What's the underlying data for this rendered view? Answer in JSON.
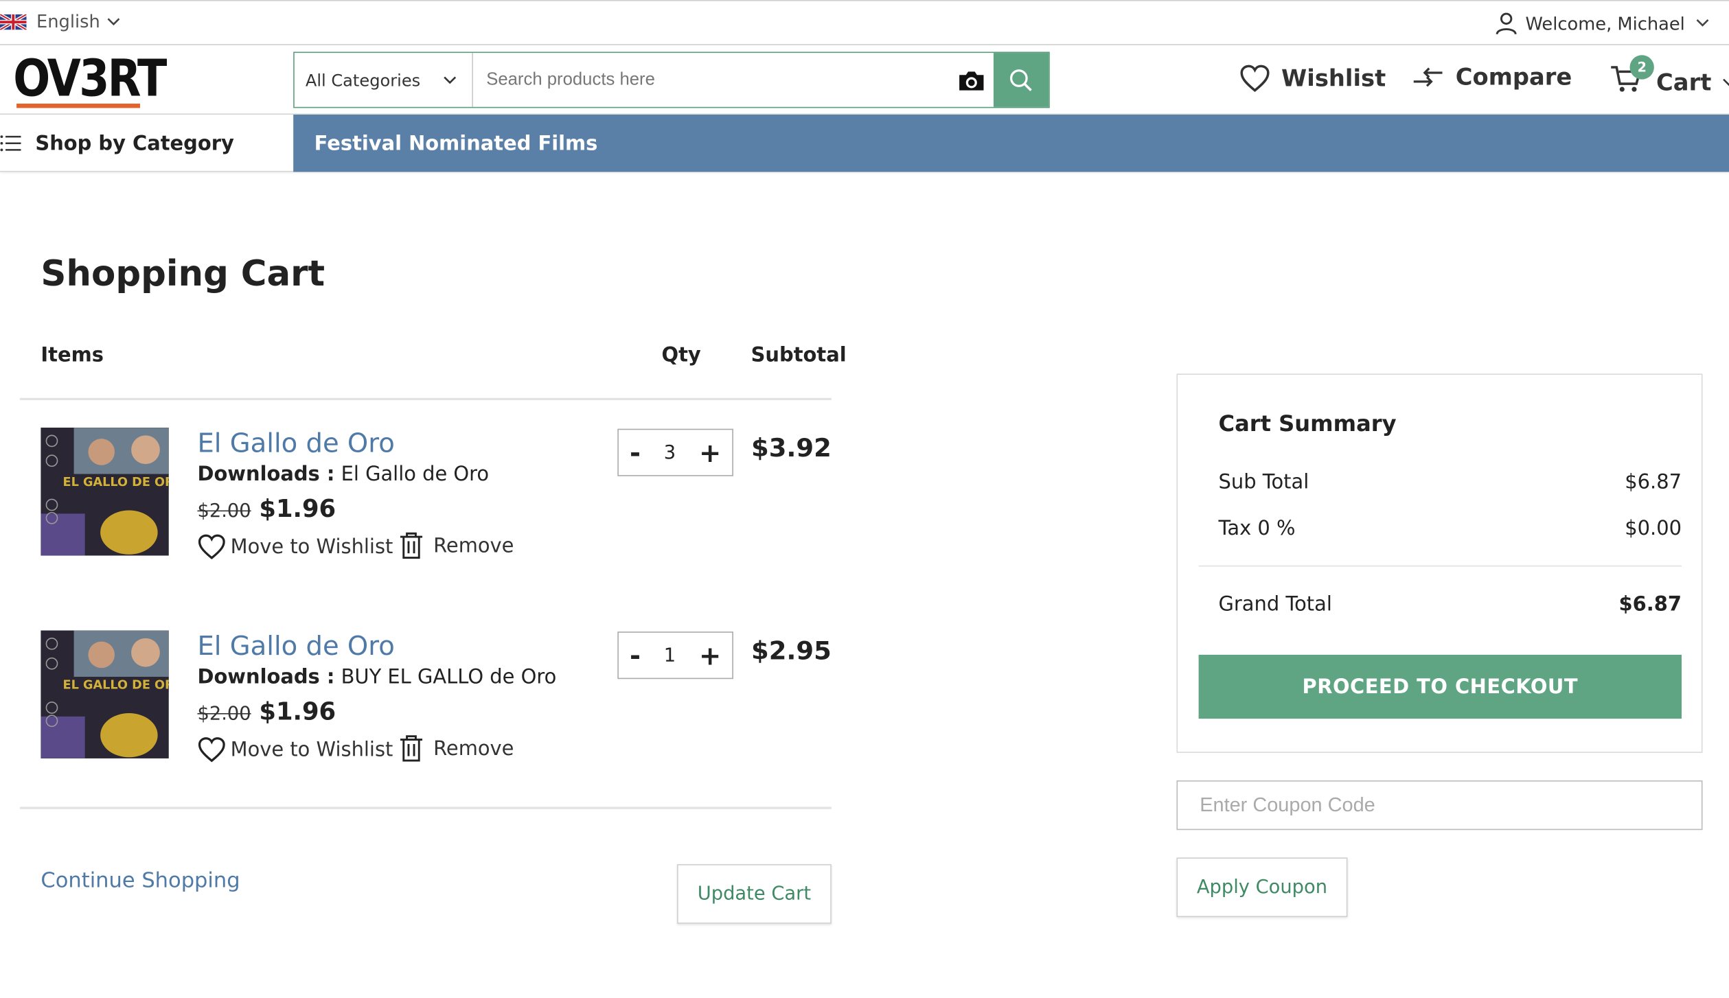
{
  "topbar": {
    "language": "English",
    "welcome": "Welcome, Michael"
  },
  "header": {
    "logo": "OV3RT",
    "category_select": "All Categories",
    "search_placeholder": "Search products here",
    "wishlist": "Wishlist",
    "compare": "Compare",
    "cart": "Cart",
    "cart_count": "2"
  },
  "nav": {
    "shop_by_category": "Shop by Category",
    "featured": "Festival Nominated Films"
  },
  "cart_page": {
    "title": "Shopping Cart",
    "columns": {
      "items": "Items",
      "qty": "Qty",
      "subtotal": "Subtotal"
    },
    "items": [
      {
        "title": "El Gallo de Oro",
        "download_label": "Downloads :",
        "download_value": " El Gallo de Oro",
        "old_price": "$2.00",
        "price": "$1.96",
        "qty": "3",
        "subtotal": "$3.92",
        "wishlist_label": "Move to Wishlist",
        "remove_label": "Remove"
      },
      {
        "title": "El Gallo de Oro",
        "download_label": "Downloads :",
        "download_value": " BUY EL GALLO de Oro",
        "old_price": "$2.00",
        "price": "$1.96",
        "qty": "1",
        "subtotal": "$2.95",
        "wishlist_label": "Move to Wishlist",
        "remove_label": "Remove"
      }
    ],
    "continue_shopping": "Continue Shopping",
    "update_cart": "Update Cart"
  },
  "summary": {
    "title": "Cart Summary",
    "sub_total_label": "Sub Total",
    "sub_total_value": "$6.87",
    "tax_label": "Tax 0 %",
    "tax_value": "$0.00",
    "grand_total_label": "Grand Total",
    "grand_total_value": "$6.87",
    "checkout": "PROCEED TO CHECKOUT"
  },
  "coupon": {
    "placeholder": "Enter Coupon Code",
    "apply": "Apply Coupon"
  },
  "colors": {
    "accent_green": "#5fa583",
    "nav_blue": "#5a80a7",
    "link_blue": "#4f7aa8",
    "logo_underline": "#e2632b"
  },
  "icons": [
    "uk-flag-icon",
    "chevron-down-icon",
    "user-icon",
    "camera-icon",
    "search-icon",
    "heart-icon",
    "compare-arrows-icon",
    "cart-icon",
    "menu-icon",
    "trash-icon"
  ]
}
